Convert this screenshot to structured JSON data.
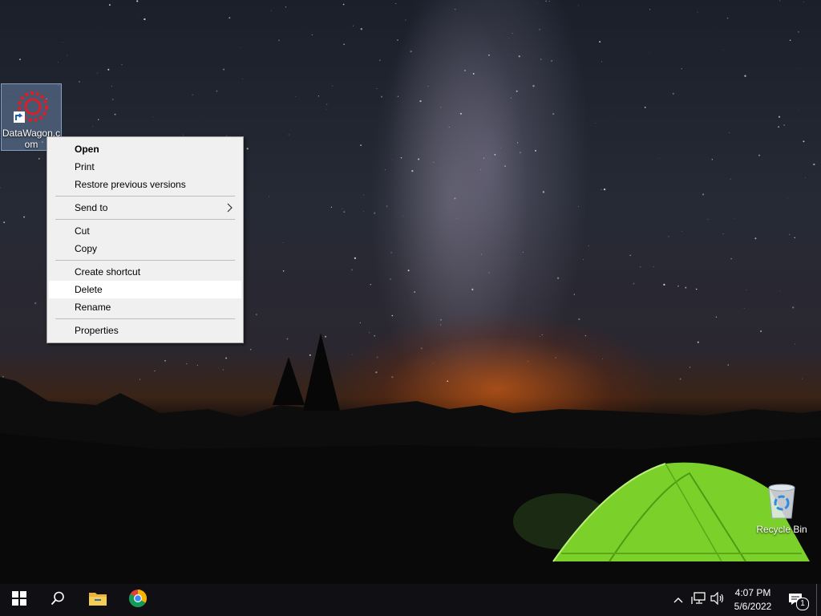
{
  "desktop": {
    "icons": [
      {
        "label": "DataWagon.c\nom"
      },
      {
        "label": "Recycle Bin"
      }
    ]
  },
  "context_menu": {
    "items": [
      {
        "label": "Open",
        "bold": true
      },
      {
        "label": "Print"
      },
      {
        "label": "Restore previous versions"
      },
      {
        "label": "Send to",
        "submenu": true
      },
      {
        "label": "Cut"
      },
      {
        "label": "Copy"
      },
      {
        "label": "Create shortcut"
      },
      {
        "label": "Delete",
        "highlighted": true
      },
      {
        "label": "Rename"
      },
      {
        "label": "Properties"
      }
    ],
    "submenu_arrow": "›"
  },
  "taskbar": {
    "time": "4:07 PM",
    "date": "5/6/2022",
    "notification_count": "1",
    "icons": [
      "windows-start-icon",
      "search-icon",
      "file-explorer-icon",
      "chrome-icon"
    ]
  },
  "colors": {
    "menu_bg": "#f0f0f0",
    "menu_hover": "#ffffff",
    "taskbar_bg": "#101014",
    "tent_green": "#7bd12a"
  }
}
